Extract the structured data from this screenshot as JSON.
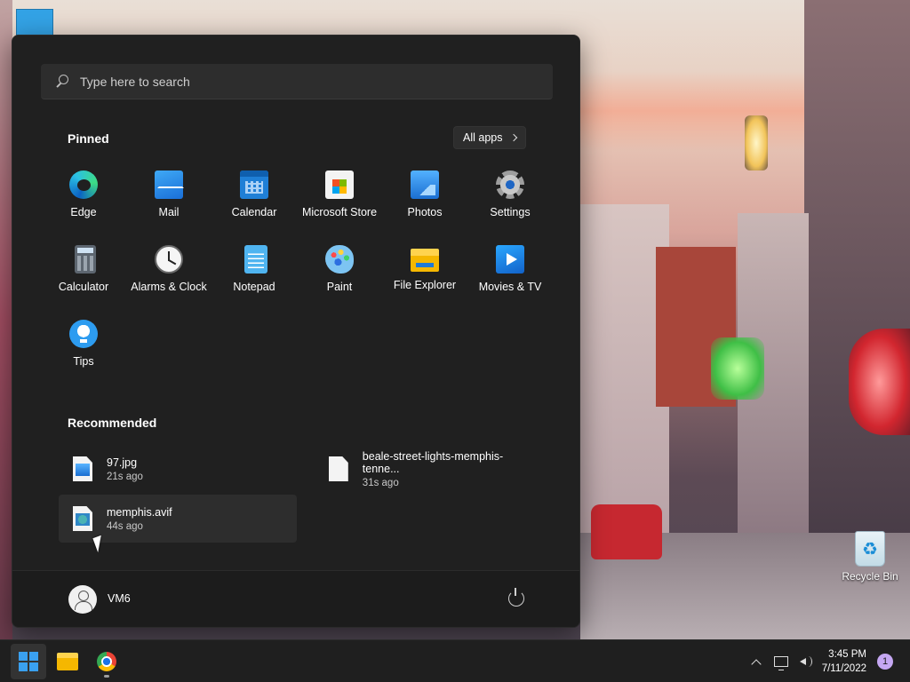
{
  "start_menu": {
    "search_placeholder": "Type here to search",
    "pinned_title": "Pinned",
    "all_apps_label": "All apps",
    "pinned_apps": [
      {
        "label": "Edge",
        "icon": "edge-icon"
      },
      {
        "label": "Mail",
        "icon": "mail-icon"
      },
      {
        "label": "Calendar",
        "icon": "calendar-icon"
      },
      {
        "label": "Microsoft Store",
        "icon": "store-icon"
      },
      {
        "label": "Photos",
        "icon": "photos-icon"
      },
      {
        "label": "Settings",
        "icon": "settings-icon"
      },
      {
        "label": "Calculator",
        "icon": "calculator-icon"
      },
      {
        "label": "Alarms & Clock",
        "icon": "clock-icon"
      },
      {
        "label": "Notepad",
        "icon": "notepad-icon"
      },
      {
        "label": "Paint",
        "icon": "paint-icon"
      },
      {
        "label": "File Explorer",
        "icon": "folder-icon"
      },
      {
        "label": "Movies & TV",
        "icon": "movies-icon"
      },
      {
        "label": "Tips",
        "icon": "tips-icon"
      }
    ],
    "recommended_title": "Recommended",
    "recommended": [
      {
        "name": "97.jpg",
        "time": "21s ago",
        "icon": "image-file-icon"
      },
      {
        "name": "beale-street-lights-memphis-tenne...",
        "time": "31s ago",
        "icon": "file-icon"
      },
      {
        "name": "memphis.avif",
        "time": "44s ago",
        "icon": "avif-file-icon"
      }
    ],
    "user_name": "VM6"
  },
  "desktop": {
    "recycle_bin_label": "Recycle Bin"
  },
  "taskbar": {
    "time": "3:45 PM",
    "date": "7/11/2022",
    "notification_count": "1"
  }
}
